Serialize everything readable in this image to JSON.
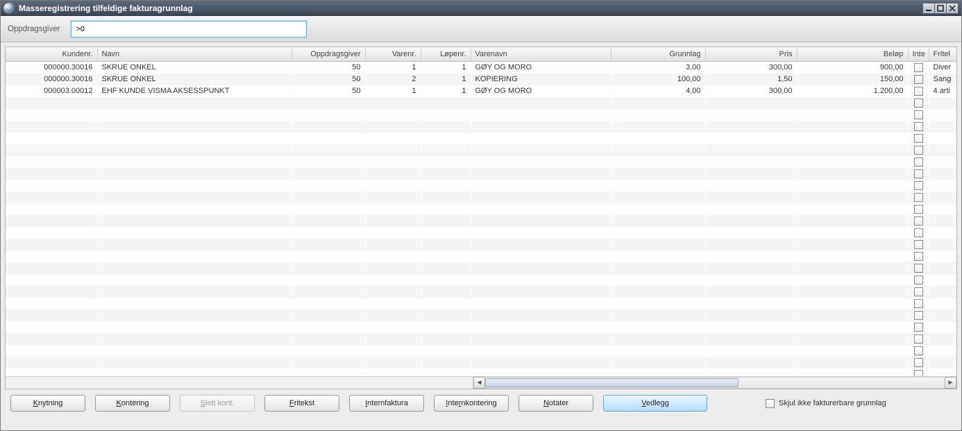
{
  "window": {
    "title": "Masseregistrering tilfeldige fakturagrunnlag"
  },
  "filter": {
    "label": "Oppdragsgiver",
    "value": ">0"
  },
  "columns": {
    "kundenr": "Kundenr.",
    "navn": "Navn",
    "oppdragsgiver": "Oppdragsgiver",
    "varenr": "Varenr.",
    "lopenr": "Løpenr.",
    "varenavn": "Varenavn",
    "grunnlag": "Grunnlag",
    "pris": "Pris",
    "belop": "Beløp",
    "inte": "Inte",
    "fritel": "Fritel"
  },
  "rows": [
    {
      "kundenr": "000000.30016",
      "navn": "SKRUE ONKEL",
      "oppdragsgiver": "50",
      "varenr": "1",
      "lopenr": "1",
      "varenavn": "GØY OG MORO",
      "grunnlag": "3,00",
      "pris": "300,00",
      "belop": "900,00",
      "fritel": "Diver"
    },
    {
      "kundenr": "000000.30016",
      "navn": "SKRUE ONKEL",
      "oppdragsgiver": "50",
      "varenr": "2",
      "lopenr": "1",
      "varenavn": "KOPIERING",
      "grunnlag": "100,00",
      "pris": "1,50",
      "belop": "150,00",
      "fritel": "Sang"
    },
    {
      "kundenr": "000003.00012",
      "navn": "EHF KUNDE VISMA AKSESSPUNKT",
      "oppdragsgiver": "50",
      "varenr": "1",
      "lopenr": "1",
      "varenavn": "GØY OG MORO",
      "grunnlag": "4,00",
      "pris": "300,00",
      "belop": "1.200,00",
      "fritel": "4 arti"
    }
  ],
  "buttons": {
    "knytning": "Knytning",
    "kontering": "Kontering",
    "slettkont": "Slett kont.",
    "fritekst": "Fritekst",
    "internfaktura": "Internfaktura",
    "internkontering": "Internkontering",
    "notater": "Notater",
    "vedlegg": "Vedlegg"
  },
  "footer": {
    "hideLabel": "Skjul ikke fakturerbare grunnlag"
  }
}
